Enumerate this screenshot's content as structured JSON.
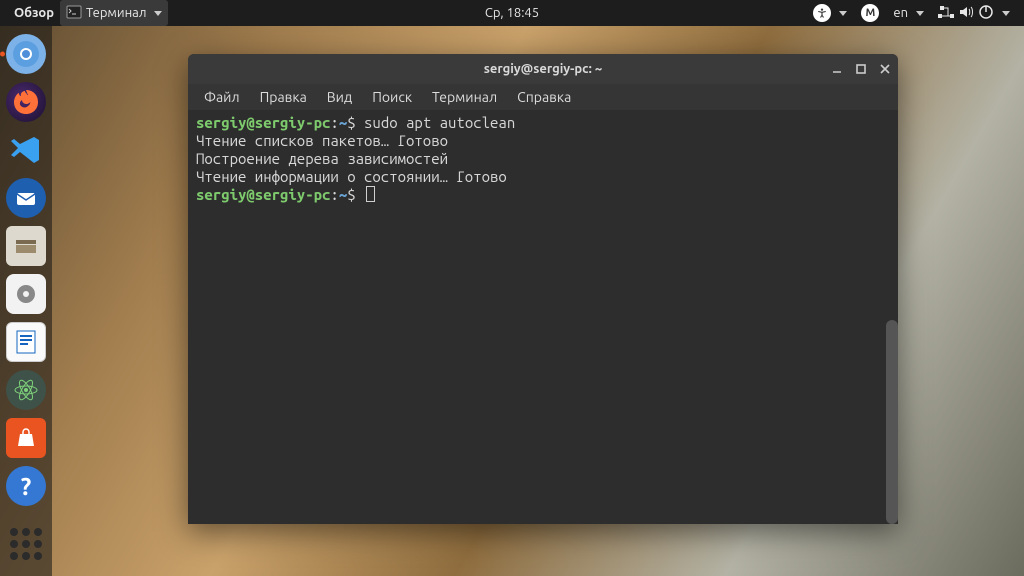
{
  "topbar": {
    "activities": "Обзор",
    "active_app": "Терминал",
    "clock": "Ср, 18:45",
    "lang": "en"
  },
  "terminal": {
    "title": "sergiy@sergiy-pc: ~",
    "menu": {
      "file": "Файл",
      "edit": "Правка",
      "view": "Вид",
      "search": "Поиск",
      "terminal": "Терминал",
      "help": "Справка"
    },
    "prompt": {
      "user_host": "sergiy@sergiy-pc",
      "sep": ":",
      "path": "~",
      "symbol": "$"
    },
    "lines": {
      "cmd1": "sudo apt autoclean",
      "out1": "Чтение списков пакетов… Готово",
      "out2": "Построение дерева зависимостей",
      "out3": "Чтение информации о состоянии… Готово"
    }
  },
  "dock": [
    {
      "name": "chromium",
      "bg": "#7db2e8",
      "fg": "#fff",
      "active": true
    },
    {
      "name": "firefox",
      "bg": "#2b2438",
      "fg": "#ff7139",
      "active": false
    },
    {
      "name": "vscode",
      "bg": "#2b2b2b",
      "fg": "#3aa0f0",
      "active": false
    },
    {
      "name": "thunderbird",
      "bg": "#1f5fb0",
      "fg": "#fff",
      "active": false
    },
    {
      "name": "files",
      "bg": "#e0ddd4",
      "fg": "#7a6a4f",
      "active": false
    },
    {
      "name": "disk-utility",
      "bg": "#f2f2f2",
      "fg": "#555",
      "active": false
    },
    {
      "name": "writer",
      "bg": "#f5f5f5",
      "fg": "#1565c0",
      "active": false
    },
    {
      "name": "atom",
      "bg": "#3f524a",
      "fg": "#7fd27a",
      "active": false
    },
    {
      "name": "software",
      "bg": "#e95420",
      "fg": "#fff",
      "active": false
    },
    {
      "name": "help",
      "bg": "#3578d4",
      "fg": "#fff",
      "active": false
    }
  ]
}
